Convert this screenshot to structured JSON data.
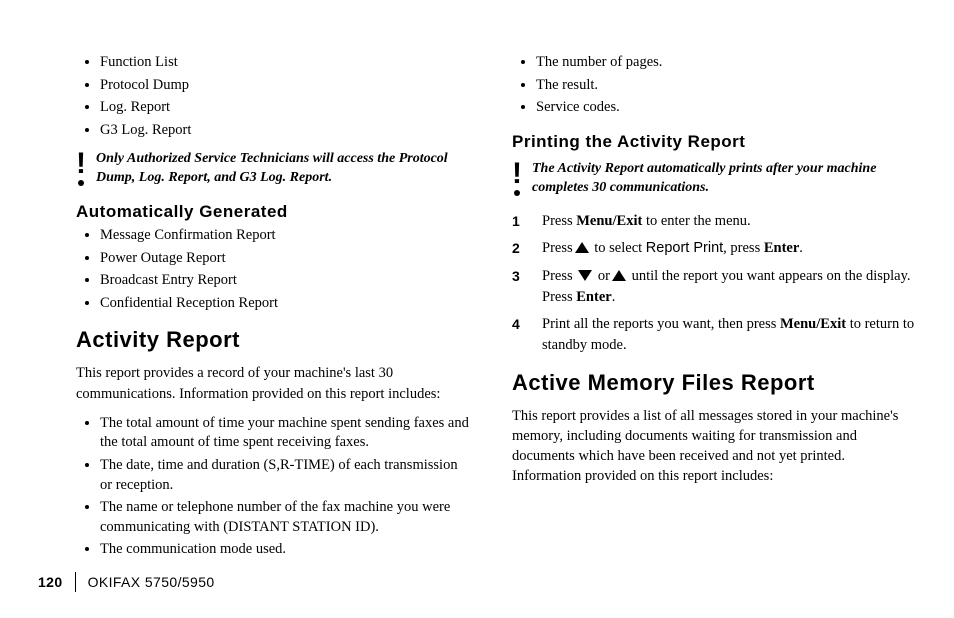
{
  "left": {
    "list1": [
      "Function List",
      "Protocol Dump",
      "Log. Report",
      "G3 Log. Report"
    ],
    "alert": "Only Authorized Service Technicians will access the Protocol Dump, Log. Report, and G3 Log. Report.",
    "autoGen": {
      "heading": "Automatically Generated",
      "items": [
        "Message Confirmation Report",
        "Power Outage Report",
        "Broadcast Entry Report",
        "Confidential Reception Report"
      ]
    },
    "activity": {
      "heading": "Activity Report",
      "para": "This report provides a record of your machine's last 30 communications. Information provided on this report includes:",
      "items": [
        "The total amount of time your machine spent sending faxes and the total amount of time spent receiving faxes.",
        "The date, time and duration (S,R-TIME) of each transmission or reception.",
        "The name or telephone number of the fax machine you were communicating with (DISTANT STATION ID).",
        "The communication mode used."
      ]
    }
  },
  "right": {
    "list1": [
      "The number of pages.",
      "The result.",
      "Service codes."
    ],
    "printing": {
      "heading": "Printing the Activity Report",
      "alert": "The Activity Report automatically prints after your machine completes 30 communications.",
      "steps": {
        "s1_a": "Press ",
        "s1_b": "Menu/Exit",
        "s1_c": " to enter the menu.",
        "s2_a": "Press",
        "s2_b": " to select ",
        "s2_c": "Report Print",
        "s2_d": ", press ",
        "s2_e": "Enter",
        "s2_f": ".",
        "s3_a": "Press ",
        "s3_b": " or",
        "s3_c": " until the report you want appears on the display.  Press ",
        "s3_d": "Enter",
        "s3_e": ".",
        "s4_a": "Print all the reports you want, then press ",
        "s4_b": "Menu/Exit",
        "s4_c": " to return to standby mode."
      }
    },
    "active": {
      "heading": "Active Memory Files Report",
      "para": "This report provides a list of all messages stored in your machine's memory, including documents waiting for transmission and documents  which have been received and not yet printed.  Information provided on this report includes:"
    }
  },
  "footer": {
    "page": "120",
    "model": "OKIFAX 5750/5950"
  }
}
